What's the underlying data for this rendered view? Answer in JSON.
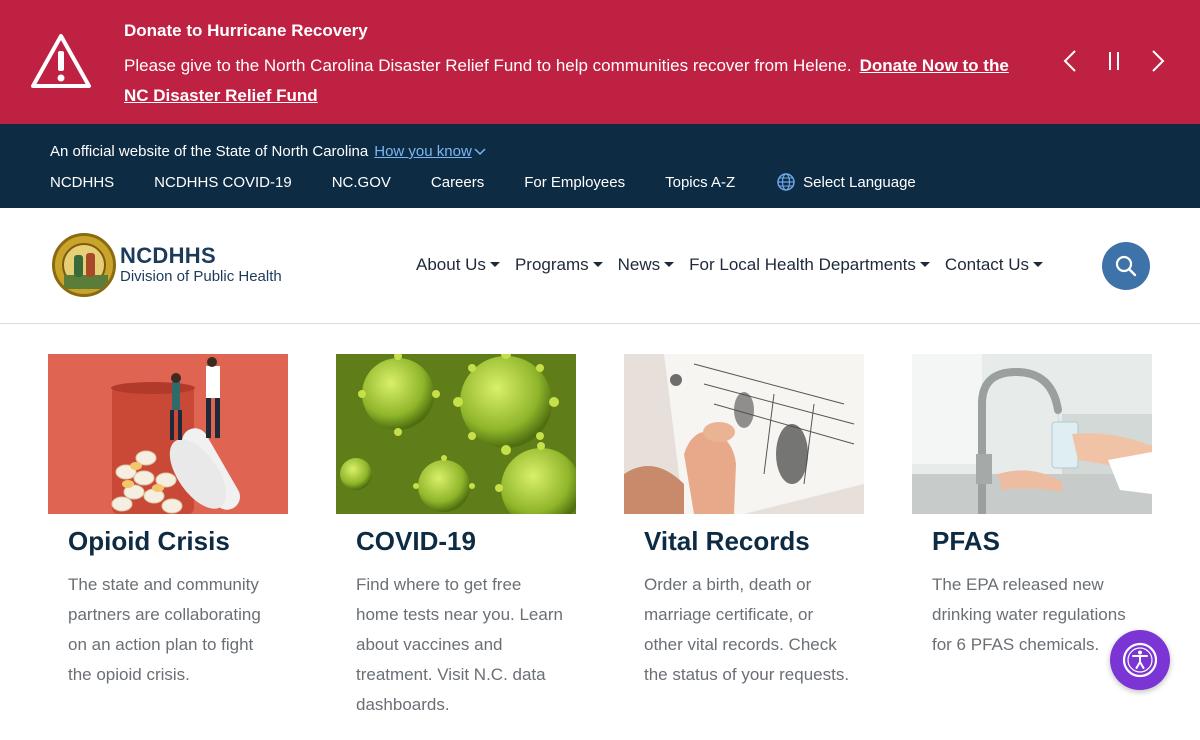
{
  "alert": {
    "title": "Donate to Hurricane Recovery",
    "text": "Please give to the North Carolina Disaster Relief Fund to help communities recover from Helene.",
    "link": "Donate Now to the NC Disaster Relief Fund",
    "bg_color": "#be2141"
  },
  "gov_bar": {
    "official_text": "An official website of the State of North Carolina",
    "how_you_know": "How you know",
    "links": [
      "NCDHHS",
      "NCDHHS COVID-19",
      "NC.GOV",
      "Careers",
      "For Employees",
      "Topics A-Z"
    ],
    "language": "Select Language",
    "bg_color": "#0e2b44"
  },
  "header": {
    "logo_title": "NCDHHS",
    "logo_subtitle": "Division of Public Health",
    "nav": [
      "About Us",
      "Programs",
      "News",
      "For Local Health Departments",
      "Contact Us"
    ]
  },
  "cards": [
    {
      "title": "Opioid Crisis",
      "description": "The state and community partners are collaborating on an action plan to fight the opioid crisis."
    },
    {
      "title": "COVID-19",
      "description": "Find where to get free home tests near you. Learn about vaccines and treatment. Visit N.C. data dashboards."
    },
    {
      "title": "Vital Records",
      "description": "Order a birth, death or marriage certificate, or other vital records. Check the status of your requests."
    },
    {
      "title": "PFAS",
      "description": "The EPA released new drinking water regulations for 6 PFAS chemicals."
    }
  ],
  "icons": {
    "alert": "warning-triangle-icon",
    "prev": "chevron-left-icon",
    "pause": "pause-icon",
    "next": "chevron-right-icon",
    "language": "globe-icon",
    "search": "search-icon",
    "accessibility": "accessibility-icon"
  }
}
